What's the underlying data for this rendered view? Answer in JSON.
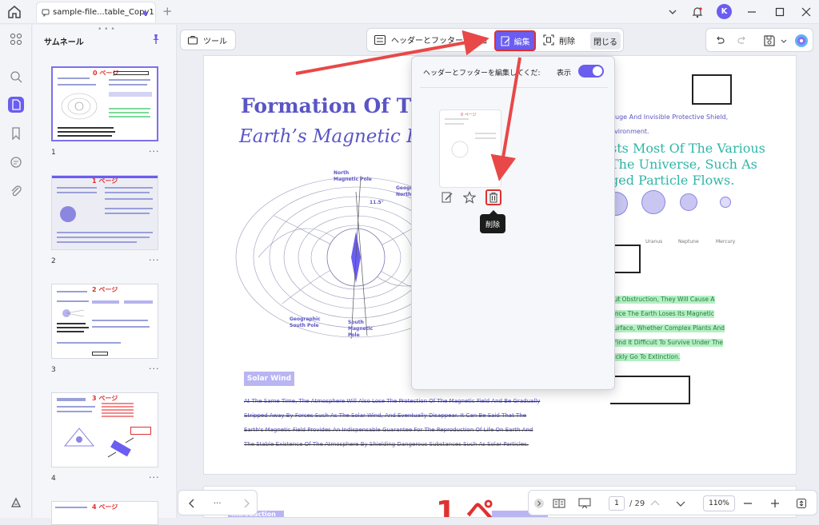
{
  "tab": {
    "title": "sample-file...table_Copy1"
  },
  "user": {
    "initial": "K"
  },
  "thumbnails": {
    "title": "サムネール",
    "pages": [
      {
        "num": "1",
        "label": "0 ページ"
      },
      {
        "num": "2",
        "label": "1 ページ"
      },
      {
        "num": "3",
        "label": "2 ページ"
      },
      {
        "num": "4",
        "label": "3 ページ"
      },
      {
        "num": "",
        "label": "4 ページ"
      }
    ],
    "more": "···"
  },
  "toolbar": {
    "tools_label": "ツール",
    "hf_add_label": "ヘッダーとフッターを追加",
    "hf_edit_label": "編集",
    "hf_delete_label": "削除",
    "hf_close_label": "閉じる"
  },
  "popup": {
    "label": "ヘッダーとフッターを編集してくだ:",
    "show_label": "表示",
    "template_label": "0 ページ",
    "tooltip": "削除"
  },
  "document": {
    "title1": "Formation Of The",
    "title2": "Earth’s Magnetic Fi",
    "north_pole": "North\nMagnetic Pole",
    "geo_north": "Geogr\nNorth",
    "geo_south": "Geographic\nSouth Pole",
    "south_pole": "South\nMagnetic\nPole",
    "angle": "11.5°",
    "right_small1": "Huge And Invisible Protective Shield,",
    "right_small2": "nvironment.",
    "right_big1": "sts Most Of The Various",
    "right_big2": "The Universe, Such As",
    "right_big3": "ged Particle Flows.",
    "planets": [
      "Uranus",
      "Neptune",
      "Mercury"
    ],
    "planet_cut": "n",
    "highlight": [
      "out Obstruction, They Will Cause A",
      "Once The Earth Loses Its Magnetic",
      "Surface, Whether Complex Plants And",
      "l Find It Difficult To Survive Under The",
      "uickly Go To Extinction."
    ],
    "solar_wind": "Solar Wind",
    "strike_lines": [
      "At The Same Time, The Atmosphere Will Also Lose The Protection Of The Magnetic Field And Be Gradually",
      "Stripped Away By Forces Such As The Solar Wind, And Eventually Disappear. It Can Be Said That The",
      "Earth's Magnetic Field Provides An Indispensable Guarantee For The Reproduction Of Life On Earth And",
      "The Stable Existence Of The Atmosphere By Shielding Dangerous Substances Such As Solar Particles."
    ],
    "page2_big": "1 ペ",
    "page2_left": "Introduction"
  },
  "bottombar": {
    "more": "···",
    "page_current": "1",
    "page_total": "/ 29",
    "zoom": "110%"
  },
  "colors": {
    "accent": "#6a5df0",
    "highlight_red": "#e03030"
  }
}
